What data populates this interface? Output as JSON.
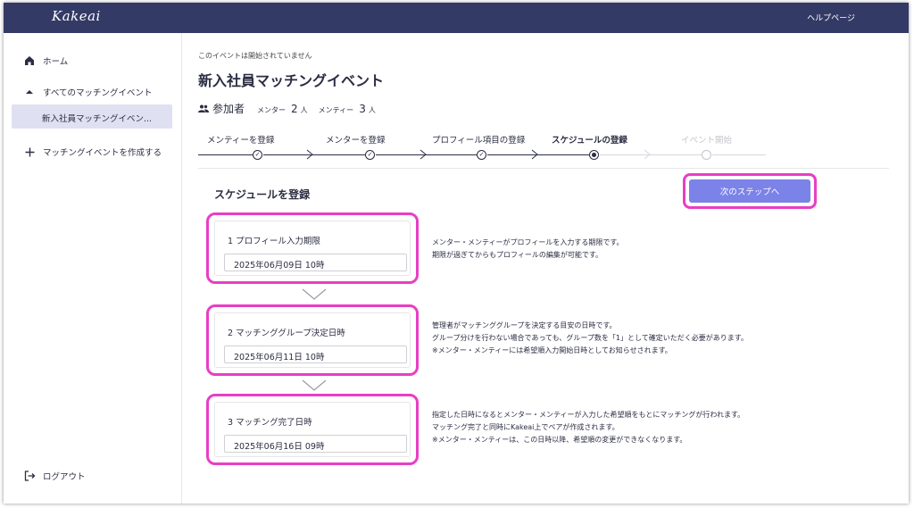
{
  "header": {
    "logo": "Kakeai",
    "help_link": "ヘルプページ"
  },
  "sidebar": {
    "home": "ホーム",
    "all_events": "すべてのマッチングイベント",
    "active_event": "新入社員マッチングイベン...",
    "create_event": "マッチングイベントを作成する",
    "logout": "ログアウト"
  },
  "main": {
    "notice": "このイベントは開始されていません",
    "title": "新入社員マッチングイベント",
    "participants": {
      "label": "参加者",
      "mentor_label": "メンター",
      "mentor_count": "2",
      "mentee_label": "メンティー",
      "mentee_count": "3",
      "unit": "人"
    },
    "steps": [
      {
        "label": "メンティーを登録",
        "state": "done"
      },
      {
        "label": "メンターを登録",
        "state": "done"
      },
      {
        "label": "プロフィール項目の登録",
        "state": "done"
      },
      {
        "label": "スケジュールの登録",
        "state": "current"
      },
      {
        "label": "イベント開始",
        "state": "future"
      }
    ],
    "section_title": "スケジュールを登録",
    "next_button": "次のステップへ",
    "schedule": [
      {
        "title": "1  プロフィール入力期限",
        "value": "2025年06月09日 10時",
        "desc": [
          "メンター・メンティーがプロフィールを入力する期限です。",
          "期限が過ぎてからもプロフィールの編集が可能です。"
        ]
      },
      {
        "title": "2  マッチンググループ決定日時",
        "value": "2025年06月11日 10時",
        "desc": [
          "管理者がマッチンググループを決定する目安の日時です。",
          "グループ分けを行わない場合であっても、グループ数を「1」として確定いただく必要があります。",
          "※メンター・メンティーには希望順入力開始日時としてお知らせされます。"
        ]
      },
      {
        "title": "3  マッチング完了日時",
        "value": "2025年06月16日 09時",
        "desc": [
          "指定した日時になるとメンター・メンティーが入力した希望順をもとにマッチングが行われます。",
          "マッチング完了と同時にKakeai上でペアが作成されます。",
          "※メンター・メンティーは、この日時以降、希望順の変更ができなくなります。"
        ]
      }
    ]
  },
  "colors": {
    "header_bg": "#343a66",
    "accent_button": "#7b82e8",
    "highlight": "#e83ec5",
    "active_nav_bg": "#dfe1f2"
  }
}
